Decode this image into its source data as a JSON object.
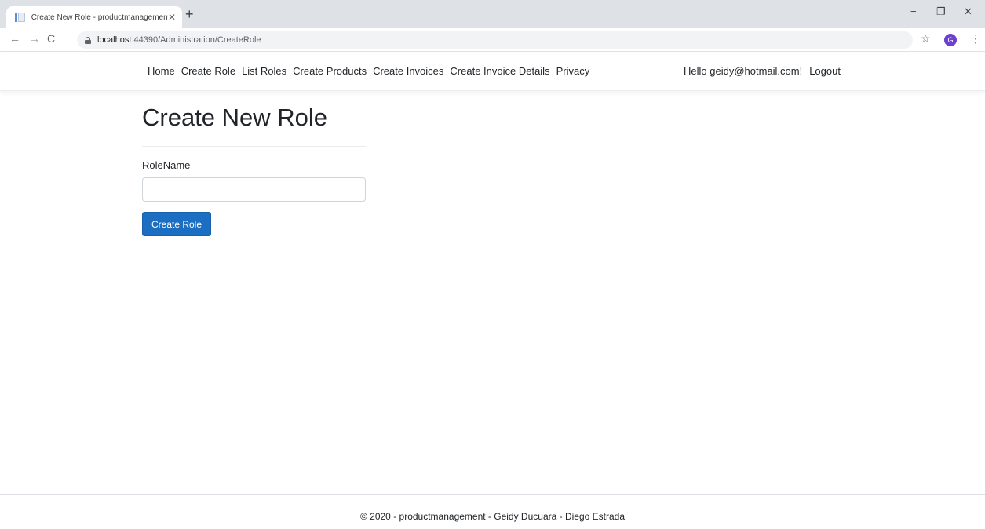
{
  "browser": {
    "tab_title": "Create New Role - productmanagement",
    "tab_close": "✕",
    "new_tab": "+",
    "url_host": "localhost",
    "url_path": ":44390/Administration/CreateRole",
    "profile_initial": "G",
    "window_controls": {
      "minimize": "−",
      "maximize": "❐",
      "close": "✕"
    },
    "nav": {
      "back": "←",
      "forward": "→",
      "reload": "C"
    },
    "icons": [
      "lock-icon",
      "star-icon",
      "menu-icon"
    ]
  },
  "site_nav": {
    "links": [
      "Home",
      "Create Role",
      "List Roles",
      "Create Products",
      "Create Invoices",
      "Create Invoice Details",
      "Privacy"
    ],
    "greeting": "Hello geidy@hotmail.com!",
    "logout": "Logout"
  },
  "page": {
    "title": "Create New Role",
    "field_label": "RoleName",
    "field_value": "",
    "submit_label": "Create Role"
  },
  "footer": {
    "text": "© 2020 - productmanagement - Geidy Ducuara - Diego Estrada"
  },
  "colors": {
    "primary_button": "#1b6ec2",
    "chrome_titlebar": "#dee1e6",
    "avatar": "#6c3fd1"
  }
}
